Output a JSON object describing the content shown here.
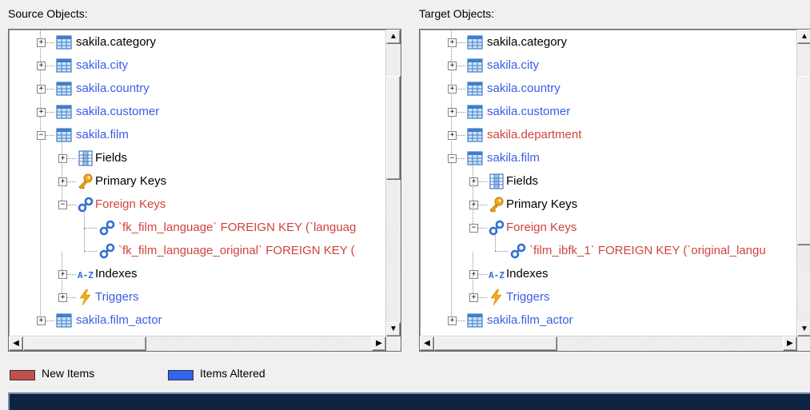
{
  "source": {
    "title": "Source Objects:",
    "rows": [
      {
        "label": "sakila.category",
        "color": "black",
        "icon": "table-icon",
        "level": 1,
        "expander": "+"
      },
      {
        "label": "sakila.city",
        "color": "blue",
        "icon": "table-icon",
        "level": 1,
        "expander": "+"
      },
      {
        "label": "sakila.country",
        "color": "blue",
        "icon": "table-icon",
        "level": 1,
        "expander": "+"
      },
      {
        "label": "sakila.customer",
        "color": "blue",
        "icon": "table-icon",
        "level": 1,
        "expander": "+"
      },
      {
        "label": "sakila.film",
        "color": "blue",
        "icon": "table-icon",
        "level": 1,
        "expander": "-"
      },
      {
        "label": "Fields",
        "color": "black",
        "icon": "fields-icon",
        "level": 2,
        "expander": "+"
      },
      {
        "label": "Primary Keys",
        "color": "black",
        "icon": "key-icon",
        "level": 2,
        "expander": "+"
      },
      {
        "label": "Foreign Keys",
        "color": "red",
        "icon": "link-icon",
        "level": 2,
        "expander": "-"
      },
      {
        "label": "`fk_film_language` FOREIGN KEY (`languag",
        "color": "red",
        "icon": "link-icon",
        "level": 3,
        "expander": ""
      },
      {
        "label": "`fk_film_language_original` FOREIGN KEY (",
        "color": "red",
        "icon": "link-icon",
        "level": 3,
        "expander": ""
      },
      {
        "label": "Indexes",
        "color": "black",
        "icon": "az-icon",
        "level": 2,
        "expander": "+"
      },
      {
        "label": "Triggers",
        "color": "blue",
        "icon": "bolt-icon",
        "level": 2,
        "expander": "+"
      },
      {
        "label": "sakila.film_actor",
        "color": "blue",
        "icon": "table-icon",
        "level": 1,
        "expander": "+"
      }
    ]
  },
  "target": {
    "title": "Target Objects:",
    "rows": [
      {
        "label": "sakila.category",
        "color": "black",
        "icon": "table-icon",
        "level": 1,
        "expander": "+"
      },
      {
        "label": "sakila.city",
        "color": "blue",
        "icon": "table-icon",
        "level": 1,
        "expander": "+"
      },
      {
        "label": "sakila.country",
        "color": "blue",
        "icon": "table-icon",
        "level": 1,
        "expander": "+"
      },
      {
        "label": "sakila.customer",
        "color": "blue",
        "icon": "table-icon",
        "level": 1,
        "expander": "+"
      },
      {
        "label": "sakila.department",
        "color": "red",
        "icon": "table-icon",
        "level": 1,
        "expander": "+"
      },
      {
        "label": "sakila.film",
        "color": "blue",
        "icon": "table-icon",
        "level": 1,
        "expander": "-"
      },
      {
        "label": "Fields",
        "color": "black",
        "icon": "fields-icon",
        "level": 2,
        "expander": "+"
      },
      {
        "label": "Primary Keys",
        "color": "black",
        "icon": "key-icon",
        "level": 2,
        "expander": "+"
      },
      {
        "label": "Foreign Keys",
        "color": "red",
        "icon": "link-icon",
        "level": 2,
        "expander": "-"
      },
      {
        "label": "`film_ibfk_1` FOREIGN KEY (`original_langu",
        "color": "red",
        "icon": "link-icon",
        "level": 3,
        "expander": ""
      },
      {
        "label": "Indexes",
        "color": "black",
        "icon": "az-icon",
        "level": 2,
        "expander": "+"
      },
      {
        "label": "Triggers",
        "color": "blue",
        "icon": "bolt-icon",
        "level": 2,
        "expander": "+"
      },
      {
        "label": "sakila.film_actor",
        "color": "blue",
        "icon": "table-icon",
        "level": 1,
        "expander": "+"
      }
    ]
  },
  "scroll_icons": {
    "up": "▲",
    "down": "▼",
    "left": "◀",
    "right": "▶"
  },
  "legend": {
    "new_items": {
      "label": "New Items",
      "color": "#c0504d"
    },
    "items_altered": {
      "label": "Items Altered",
      "color": "#3366ee"
    }
  },
  "colors": {
    "black": "#000000",
    "blue": "#3a5de6",
    "red": "#d0443c"
  }
}
